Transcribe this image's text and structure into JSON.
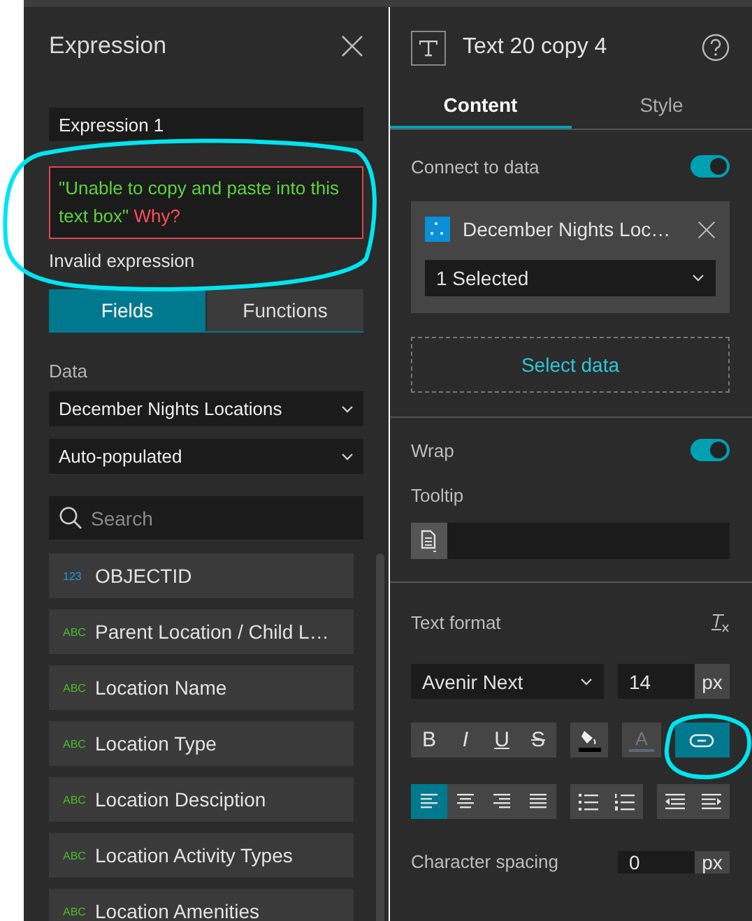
{
  "expression_panel": {
    "title": "Expression",
    "name_value": "Expression 1",
    "editor_segments": [
      {
        "kind": "string",
        "text": "\"Unable to copy and paste into this text box\""
      },
      {
        "kind": "error",
        "text": "Why?"
      }
    ],
    "validation_message": "Invalid expression",
    "tabs": [
      {
        "label": "Fields",
        "selected": true
      },
      {
        "label": "Functions",
        "selected": false
      }
    ],
    "data_label": "Data",
    "source_dropdown": "December Nights Locations",
    "mode_dropdown": "Auto-populated",
    "search": {
      "placeholder": "Search"
    },
    "fields": [
      {
        "kind": "number",
        "type_label": "123",
        "name": "OBJECTID"
      },
      {
        "kind": "text",
        "type_label": "ABC",
        "name": "Parent Location / Child L…"
      },
      {
        "kind": "text",
        "type_label": "ABC",
        "name": "Location Name"
      },
      {
        "kind": "text",
        "type_label": "ABC",
        "name": "Location Type"
      },
      {
        "kind": "text",
        "type_label": "ABC",
        "name": "Location Desciption"
      },
      {
        "kind": "text",
        "type_label": "ABC",
        "name": "Location Activity Types"
      },
      {
        "kind": "text",
        "type_label": "ABC",
        "name": "Location Amenities"
      }
    ]
  },
  "settings_panel": {
    "title": "Text 20 copy 4",
    "tabs": [
      {
        "label": "Content",
        "selected": true
      },
      {
        "label": "Style",
        "selected": false
      }
    ],
    "connect_to_data": {
      "label": "Connect to data",
      "on": true
    },
    "data_source": {
      "name": "December Nights Loc…",
      "selection": "1 Selected"
    },
    "select_data_button": "Select data",
    "wrap": {
      "label": "Wrap",
      "on": true
    },
    "tooltip_label": "Tooltip",
    "text_format_label": "Text format",
    "font": "Avenir Next",
    "font_size": "14",
    "font_size_unit": "px",
    "style_buttons": [
      {
        "kind": "bold",
        "label": "B"
      },
      {
        "kind": "italic",
        "label": "I"
      },
      {
        "kind": "underline",
        "label": "U"
      },
      {
        "kind": "strike",
        "label": "S"
      }
    ],
    "font_color_button": {
      "label": "A",
      "disabled": true
    },
    "link_button": {
      "selected": true
    },
    "alignment": [
      {
        "kind": "left",
        "selected": true
      },
      {
        "kind": "center",
        "selected": false
      },
      {
        "kind": "right",
        "selected": false
      },
      {
        "kind": "justify",
        "selected": false
      }
    ],
    "list_buttons": [
      {
        "kind": "bullet"
      },
      {
        "kind": "numbered"
      }
    ],
    "indent_buttons": [
      {
        "kind": "outdent"
      },
      {
        "kind": "indent"
      }
    ],
    "character_spacing": {
      "label": "Character spacing",
      "value": "0",
      "unit": "px"
    }
  }
}
